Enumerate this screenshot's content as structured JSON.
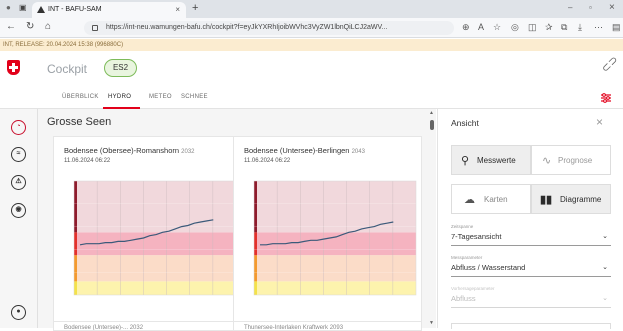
{
  "browser": {
    "tab_title": "INT - BAFU-SAM",
    "tab_close": "×",
    "new_tab": "+",
    "url": "https://int-neu.wamungen-bafu.ch/cockpit?f=eyJkYXRhIjoibWVhc3VyZW1lbnQiLCJ2aWV...",
    "win_min": "–",
    "win_max": "▫",
    "win_close": "×"
  },
  "release_banner": "INT, RELEASE: 20.04.2024 15:38 (996880C)",
  "header": {
    "title": "Cockpit",
    "badge": "ES2"
  },
  "subnav": {
    "tabs": [
      {
        "label": "ÜBERBLICK",
        "active": false
      },
      {
        "label": "HYDRO",
        "active": true
      },
      {
        "label": "METEO",
        "active": false
      },
      {
        "label": "SCHNEE",
        "active": false
      }
    ]
  },
  "sidebar": {
    "items": [
      {
        "icon": "gauge-icon",
        "glyph": "◔"
      },
      {
        "icon": "water-level-icon",
        "glyph": "≈"
      },
      {
        "icon": "warning-person-icon",
        "glyph": "⚠"
      },
      {
        "icon": "eye-settings-icon",
        "glyph": "◉"
      }
    ],
    "bottom_icon": {
      "icon": "user-icon",
      "glyph": "●"
    }
  },
  "main": {
    "title": "Grosse Seen",
    "cards": [
      {
        "name": "Bodensee (Obersee)-Romanshorn",
        "code": "2032",
        "date": "11.06.2024 06:22"
      },
      {
        "name": "Bodensee (Untersee)-Berlingen",
        "code": "2043",
        "date": "11.06.2024 06:22"
      }
    ],
    "partial_cards": [
      "Bodensee (Untersee)-... 2032",
      "Thunersee-Interlaken Kraftwerk 2093"
    ]
  },
  "panel": {
    "title": "Ansicht",
    "close": "×",
    "mode_buttons": [
      {
        "label": "Messwerte",
        "active": true,
        "icon": "location-pin-icon"
      },
      {
        "label": "Prognose",
        "active": false,
        "icon": "trend-icon"
      }
    ],
    "view_buttons": [
      {
        "label": "Karten",
        "active": false,
        "icon": "map-icon"
      },
      {
        "label": "Diagramme",
        "active": true,
        "icon": "bar-chart-icon"
      }
    ],
    "fields": [
      {
        "label": "Zeitspanne",
        "value": "7-Tagesansicht",
        "disabled": false
      },
      {
        "label": "Messparameter",
        "value": "Abfluss / Wasserstand",
        "disabled": false
      },
      {
        "label": "Vorhersageparameter",
        "value": "Abfluss",
        "disabled": true
      }
    ]
  },
  "colors": {
    "accent_red": "#e2001a",
    "danger_band": "#f5b3c0",
    "moderate_band": "#fbdcc8",
    "low_band": "#fdf3ad",
    "line": "#3b5a7a",
    "active_seg": "#eeeeee"
  },
  "chart_data": [
    {
      "type": "line",
      "title": "Bodensee (Obersee)-Romanshorn",
      "series": [
        {
          "values": [
            0.44,
            0.45,
            0.45,
            0.45,
            0.46,
            0.46,
            0.47,
            0.47,
            0.48,
            0.49,
            0.5,
            0.52,
            0.53,
            0.55,
            0.56,
            0.58,
            0.6,
            0.61,
            0.63,
            0.64,
            0.65,
            0.66
          ]
        }
      ]
    },
    {
      "type": "line",
      "title": "Bodensee (Untersee)-Berlingen",
      "series": [
        {
          "values": [
            0.44,
            0.44,
            0.45,
            0.45,
            0.45,
            0.46,
            0.46,
            0.47,
            0.48,
            0.48,
            0.49,
            0.5,
            0.51,
            0.53,
            0.55,
            0.56,
            0.58,
            0.59,
            0.6,
            0.62,
            0.63,
            0.64
          ]
        }
      ]
    }
  ]
}
